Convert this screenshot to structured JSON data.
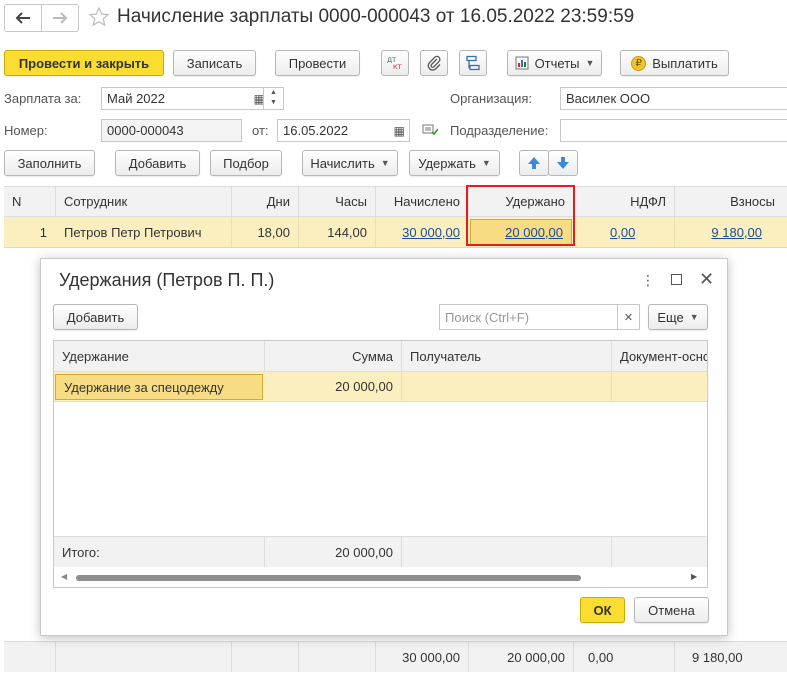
{
  "window": {
    "title": "Начисление зарплаты 0000-000043 от 16.05.2022 23:59:59",
    "back_icon": "arrow-left-icon",
    "forward_icon": "arrow-right-icon",
    "favorite_icon": "star-icon"
  },
  "toolbar": {
    "post_close": "Провести и закрыть",
    "save": "Записать",
    "post": "Провести",
    "dt_kt": "Дт Кт",
    "reports": "Отчеты",
    "pay": "Выплатить"
  },
  "form": {
    "salary_for_label": "Зарплата за:",
    "salary_for_value": "Май 2022",
    "org_label": "Организация:",
    "org_value": "Василек ООО",
    "number_label": "Номер:",
    "number_value": "0000-000043",
    "from_label": "от:",
    "date_value": "16.05.2022",
    "dept_label": "Подразделение:",
    "dept_value": ""
  },
  "actions": {
    "fill": "Заполнить",
    "add": "Добавить",
    "select": "Подбор",
    "accrue": "Начислить",
    "withhold": "Удержать"
  },
  "table": {
    "headers": [
      "N",
      "Сотрудник",
      "Дни",
      "Часы",
      "Начислено",
      "Удержано",
      "НДФЛ",
      "Взносы"
    ],
    "row": {
      "n": "1",
      "employee": "Петров Петр Петрович",
      "days": "18,00",
      "hours": "144,00",
      "accrued": "30 000,00",
      "withheld": "20 000,00",
      "ndfl": "0,00",
      "contrib": "9 180,00"
    },
    "footer": {
      "accrued": "30 000,00",
      "withheld": "20 000,00",
      "ndfl": "0,00",
      "contrib": "9 180,00"
    }
  },
  "dialog": {
    "title": "Удержания (Петров П. П.)",
    "add": "Добавить",
    "search_placeholder": "Поиск (Ctrl+F)",
    "more": "Еще",
    "headers": [
      "Удержание",
      "Сумма",
      "Получатель",
      "Документ-осно"
    ],
    "row": {
      "type": "Удержание за спецодежду",
      "sum": "20 000,00",
      "recipient": "",
      "doc": ""
    },
    "total_label": "Итого:",
    "total_value": "20 000,00",
    "ok": "ОК",
    "cancel": "Отмена"
  },
  "colors": {
    "accent": "#f9dd30",
    "selection": "#fbefbf",
    "highlight_border": "#e02020",
    "link": "#1a4e9c"
  }
}
